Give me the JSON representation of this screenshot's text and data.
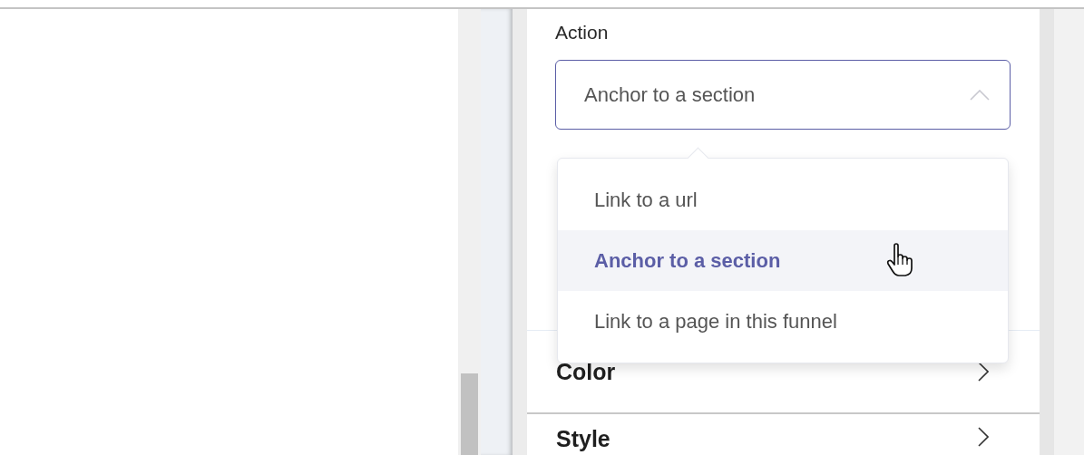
{
  "action": {
    "label": "Action",
    "value": "Anchor to a section",
    "expanded": true,
    "options": [
      {
        "label": "Link to a url",
        "selected": false
      },
      {
        "label": "Anchor to a section",
        "selected": true
      },
      {
        "label": "Link to a page in this funnel",
        "selected": false
      }
    ]
  },
  "sections": [
    {
      "title": "Color"
    },
    {
      "title": "Style"
    }
  ]
}
